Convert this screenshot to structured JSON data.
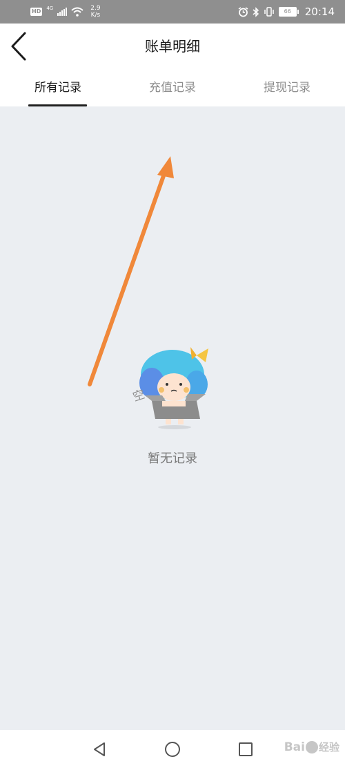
{
  "status_bar": {
    "hd_label": "HD",
    "network_type": "4G",
    "speed_value": "2.9",
    "speed_unit": "K/s",
    "battery_level": "66",
    "time": "20:14",
    "icons": [
      "wifi-icon",
      "alarm-icon",
      "bluetooth-icon",
      "vibrate-icon"
    ]
  },
  "header": {
    "title": "账单明细",
    "back_icon": "chevron-left-icon"
  },
  "tabs": [
    {
      "label": "所有记录",
      "active": true
    },
    {
      "label": "充值记录",
      "active": false
    },
    {
      "label": "提现记录",
      "active": false
    }
  ],
  "empty_state": {
    "illustration_caption": "空",
    "message": "暂无记录"
  },
  "annotation": {
    "arrow_color": "#f0883a"
  },
  "nav_bar": {
    "buttons": [
      "back-triangle-icon",
      "home-circle-icon",
      "recents-square-icon"
    ]
  },
  "watermark": {
    "text_prefix": "Bai",
    "text_suffix": "经验"
  },
  "colors": {
    "background": "#ebeef2",
    "status_bar": "#8f8f8f",
    "active_tab": "#1a1a1a",
    "inactive_tab": "#8c8c8c"
  }
}
